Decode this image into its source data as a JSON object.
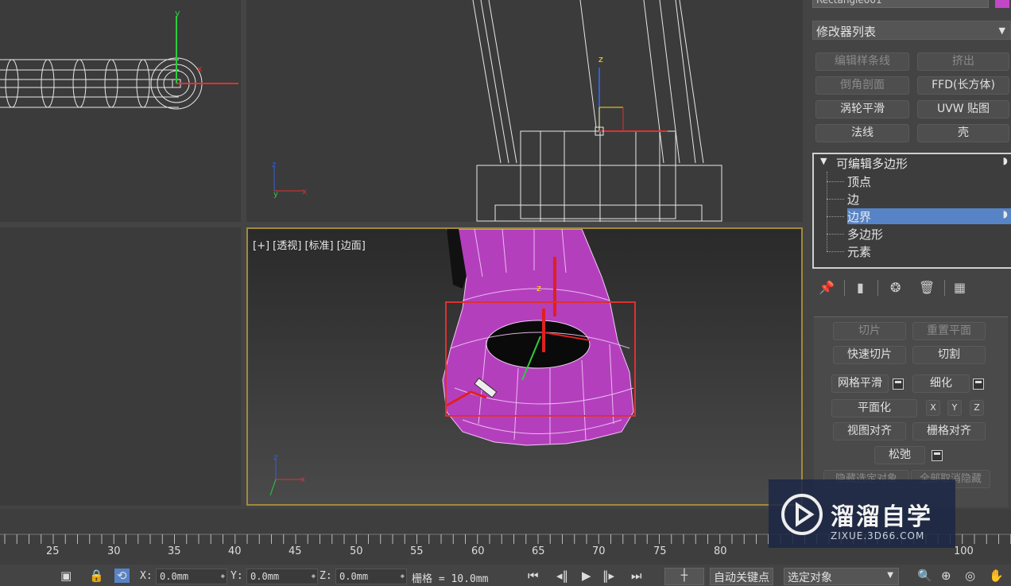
{
  "viewports": {
    "perspective_label": "[+] [透视] [标准] [边面]"
  },
  "panel": {
    "object_name": "Rectangle001",
    "object_color": "#c247c6",
    "modifier_list": "修改器列表",
    "buttons": [
      {
        "label": "编辑样条线",
        "dim": true
      },
      {
        "label": "挤出",
        "dim": true
      },
      {
        "label": "倒角剖面",
        "dim": true
      },
      {
        "label": "FFD(长方体)",
        "dim": false
      },
      {
        "label": "涡轮平滑",
        "dim": false
      },
      {
        "label": "UVW 贴图",
        "dim": false
      },
      {
        "label": "法线",
        "dim": false
      },
      {
        "label": "壳",
        "dim": false
      }
    ],
    "stack": {
      "root": "可编辑多边形",
      "items": [
        "顶点",
        "边",
        "边界",
        "多边形",
        "元素"
      ],
      "selected": "边界"
    },
    "rollout": {
      "slice": "切片",
      "reset_plane": "重置平面",
      "quick_slice": "快速切片",
      "cut": "切割",
      "meshsmooth": "网格平滑",
      "tessellate": "细化",
      "make_planar": "平面化",
      "x": "X",
      "y": "Y",
      "z": "Z",
      "view_align": "视图对齐",
      "grid_align": "栅格对齐",
      "relax": "松弛",
      "hide_selected": "隐藏选定对象",
      "unhide_all": "全部取消隐藏"
    }
  },
  "timeline": {
    "ticks": [
      "25",
      "30",
      "35",
      "40",
      "45",
      "50",
      "55",
      "60",
      "65",
      "70",
      "75",
      "80",
      "100"
    ]
  },
  "status": {
    "x_label": "X:",
    "x_value": "0.0mm",
    "y_label": "Y:",
    "y_value": "0.0mm",
    "z_label": "Z:",
    "z_value": "0.0mm",
    "grid_label": "栅格 = 10.0mm",
    "auto_key": "自动关键点",
    "selection": "选定对象"
  },
  "watermark": {
    "title": "溜溜自学",
    "url": "ZIXUE.3D66.COM"
  },
  "colors": {
    "accent_selection": "#5784c6",
    "object_magenta": "#b43fbd",
    "viewport_border_active": "#a08a3a",
    "highlight_box": "#e03030"
  }
}
